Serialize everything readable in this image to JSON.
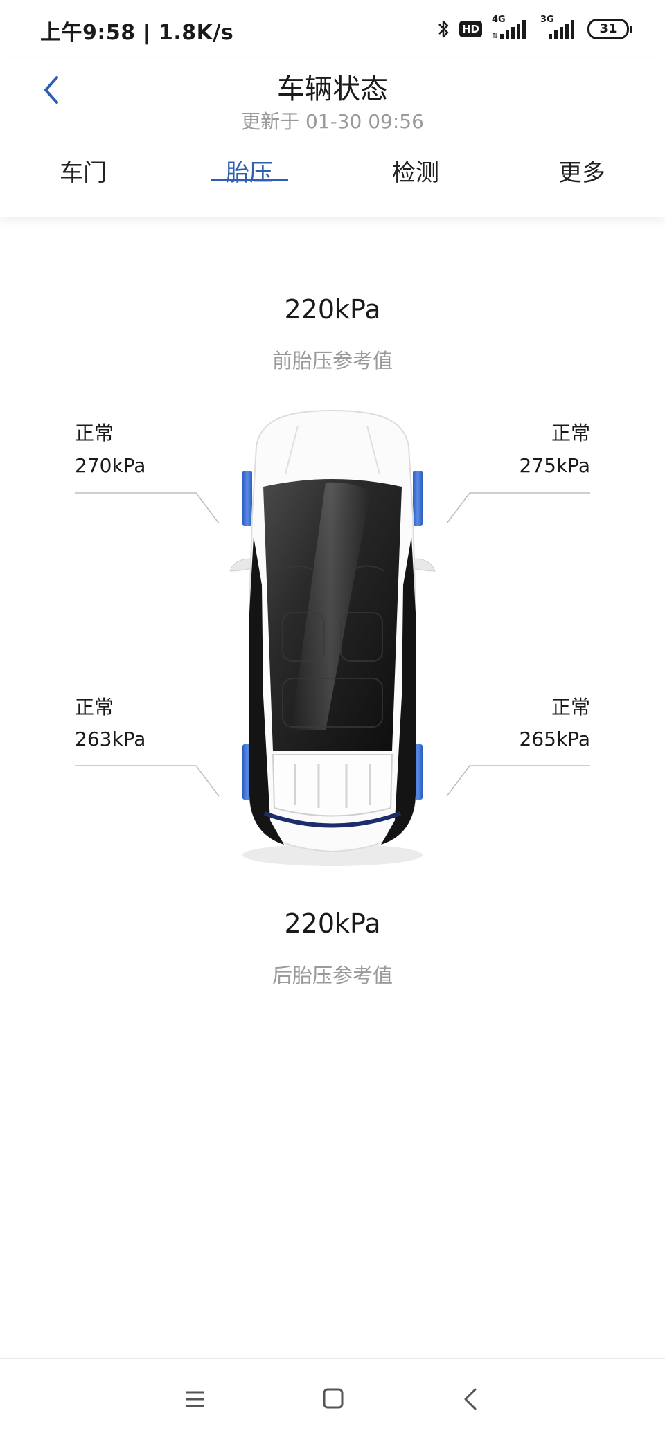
{
  "status_bar": {
    "time": "上午9:58 | 1.8K/s",
    "hd_badge": "HD",
    "network1": "4G",
    "network2": "3G",
    "battery": "31",
    "icons": [
      "bluetooth-icon",
      "hd-icon",
      "signal-4g-icon",
      "signal-3g-icon",
      "battery-icon"
    ]
  },
  "header": {
    "title": "车辆状态",
    "update_time": "更新于 01-30 09:56",
    "back_icon": "chevron-left-icon"
  },
  "tabs": [
    {
      "label": "车门",
      "active": false
    },
    {
      "label": "胎压",
      "active": true
    },
    {
      "label": "检测",
      "active": false
    },
    {
      "label": "更多",
      "active": false
    }
  ],
  "tire_pressure": {
    "front_reference": {
      "value": "220kPa",
      "label": "前胎压参考值"
    },
    "rear_reference": {
      "value": "220kPa",
      "label": "后胎压参考值"
    },
    "front_left": {
      "status": "正常",
      "value": "270kPa"
    },
    "front_right": {
      "status": "正常",
      "value": "275kPa"
    },
    "rear_left": {
      "status": "正常",
      "value": "263kPa"
    },
    "rear_right": {
      "status": "正常",
      "value": "265kPa"
    }
  },
  "nav_bar": {
    "icons": [
      "menu-icon",
      "home-icon",
      "back-icon"
    ]
  },
  "colors": {
    "accent": "#2f5fb0",
    "tire_highlight": "#3f74d6",
    "secondary_text": "#9a9a9a",
    "primary_text": "#1a1a1a"
  }
}
